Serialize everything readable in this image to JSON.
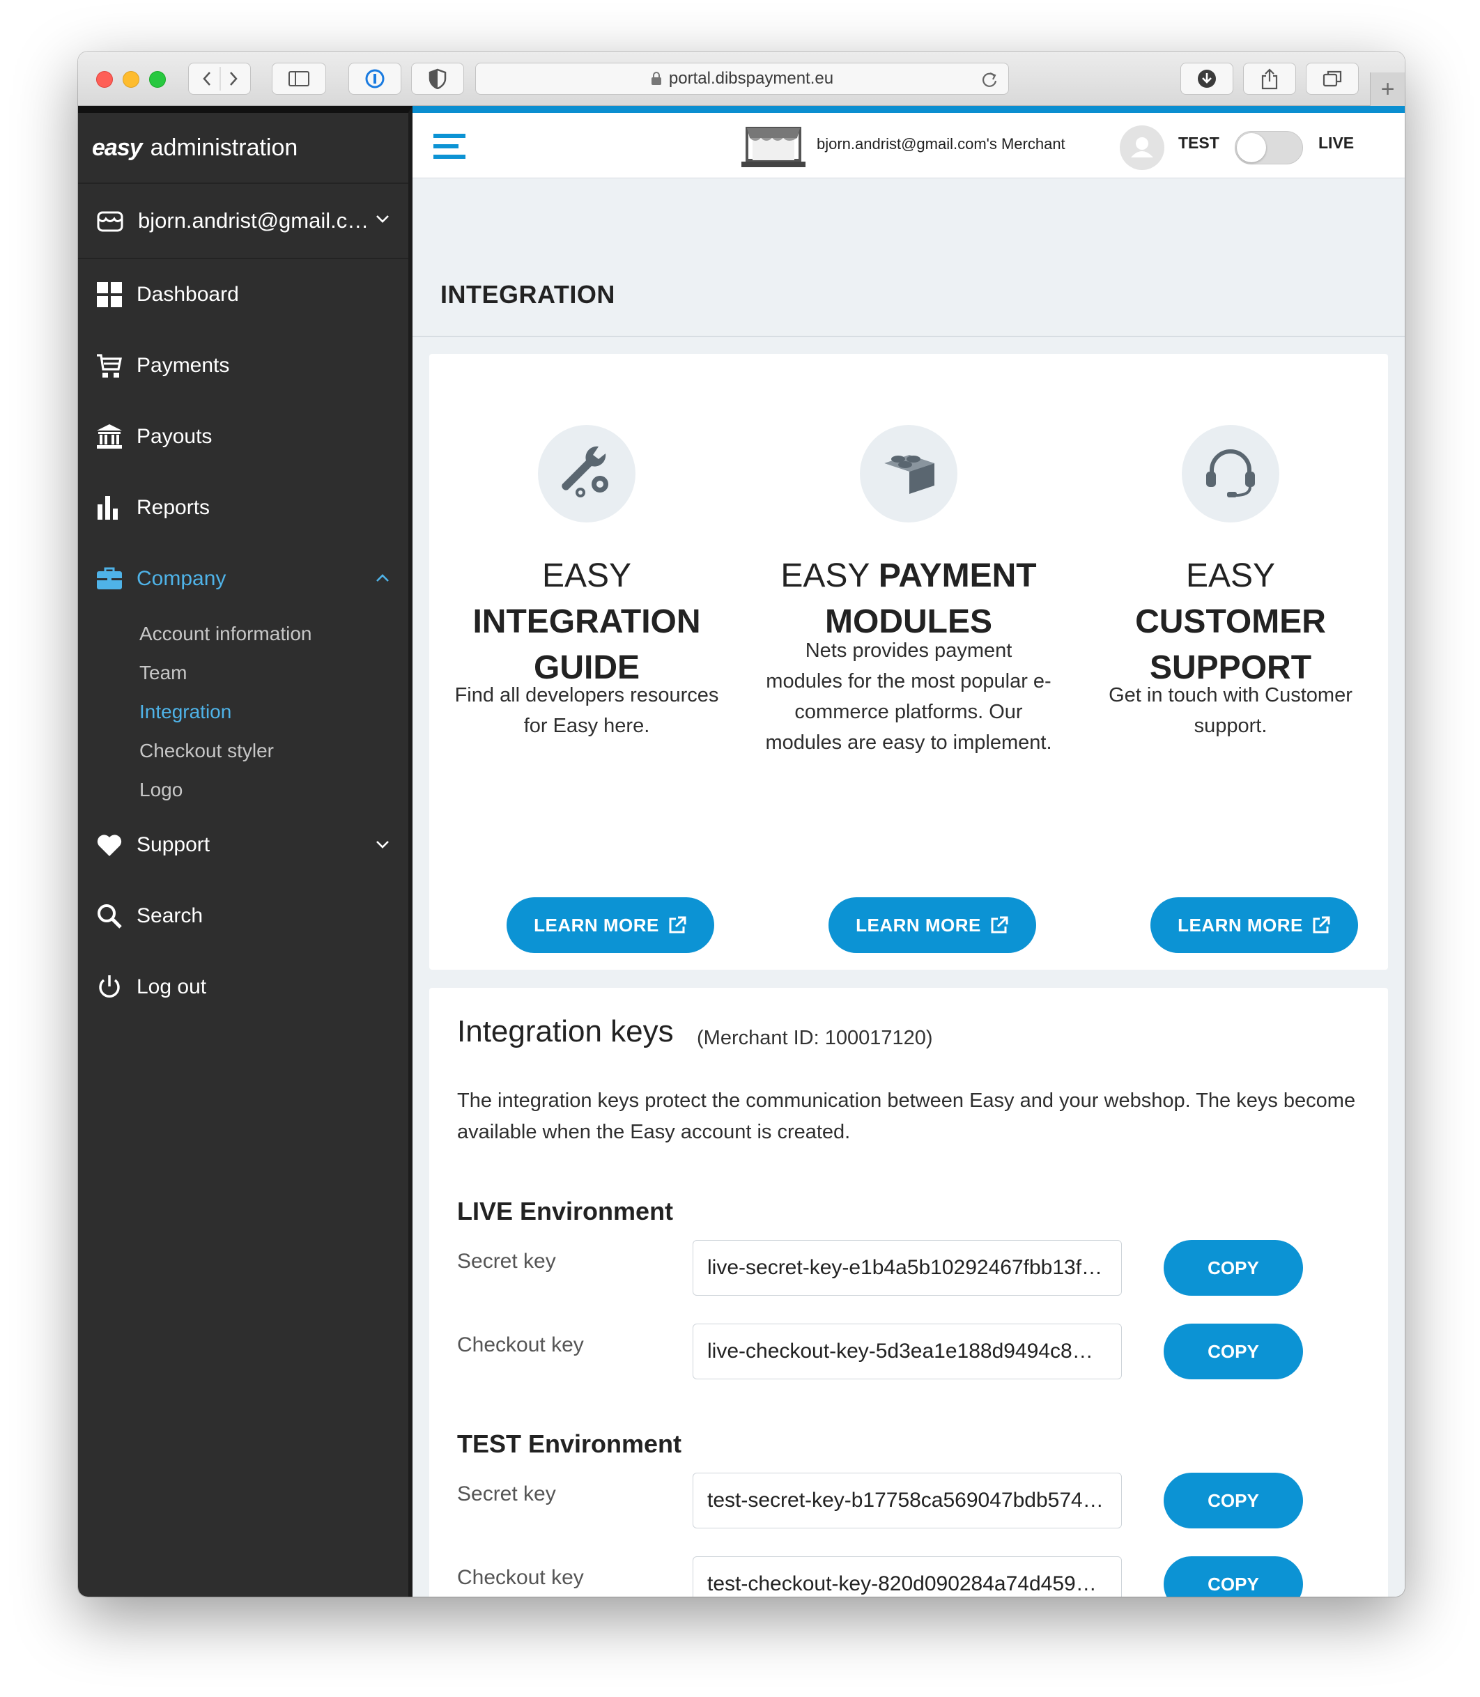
{
  "browser": {
    "url": "portal.dibspayment.eu"
  },
  "sidebar": {
    "brand_logo": "easy",
    "brand_text": "administration",
    "account": "bjorn.andrist@gmail.c…",
    "items": [
      {
        "label": "Dashboard",
        "icon": "grid-icon"
      },
      {
        "label": "Payments",
        "icon": "cart-icon"
      },
      {
        "label": "Payouts",
        "icon": "bank-icon"
      },
      {
        "label": "Reports",
        "icon": "bar-chart-icon"
      },
      {
        "label": "Company",
        "icon": "briefcase-icon",
        "active": true,
        "expanded": true
      },
      {
        "label": "Support",
        "icon": "heart-icon"
      },
      {
        "label": "Search",
        "icon": "search-icon"
      },
      {
        "label": "Log out",
        "icon": "power-icon"
      }
    ],
    "company_subitems": [
      {
        "label": "Account information"
      },
      {
        "label": "Team"
      },
      {
        "label": "Integration",
        "active": true
      },
      {
        "label": "Checkout styler"
      },
      {
        "label": "Logo"
      }
    ]
  },
  "topbar": {
    "merchant": "bjorn.andrist@gmail.com's Merchant",
    "mode_test": "TEST",
    "mode_live": "LIVE"
  },
  "page": {
    "title": "INTEGRATION"
  },
  "features": [
    {
      "title_light": "EASY",
      "title_bold_1": "INTEGRATION",
      "title_bold_2": "GUIDE",
      "description": "Find all developers resources for Easy here.",
      "button": "LEARN MORE",
      "icon": "wrench-gear-icon"
    },
    {
      "title_light": "EASY",
      "title_bold_1": "PAYMENT",
      "title_bold_2": "MODULES",
      "description": "Nets provides payment modules for the most popular e-commerce platforms. Our modules are easy to implement.",
      "button": "LEARN MORE",
      "icon": "lego-brick-icon"
    },
    {
      "title_light": "EASY",
      "title_bold_1": "CUSTOMER",
      "title_bold_2": "SUPPORT",
      "description": "Get in touch with Customer support.",
      "button": "LEARN MORE",
      "icon": "headset-icon"
    }
  ],
  "keys": {
    "title": "Integration keys",
    "merchant_id": "(Merchant ID: 100017120)",
    "description": "The integration keys protect the communication between Easy and your webshop. The keys become available when the Easy account is created.",
    "live": {
      "title": "LIVE Environment",
      "secret_label": "Secret key",
      "secret_value": "live-secret-key-e1b4a5b10292467fbb13f…",
      "checkout_label": "Checkout key",
      "checkout_value": "live-checkout-key-5d3ea1e188d9494c8…",
      "copy": "COPY"
    },
    "test": {
      "title": "TEST Environment",
      "secret_label": "Secret key",
      "secret_value": "test-secret-key-b17758ca569047bdb574…",
      "checkout_label": "Checkout key",
      "checkout_value": "test-checkout-key-820d090284a74d459…",
      "copy": "COPY"
    }
  },
  "colors": {
    "accent": "#0c93d4",
    "sidebar_bg": "#2e2e2e",
    "active_link": "#4fb3e8",
    "page_bg": "#edf1f4"
  }
}
